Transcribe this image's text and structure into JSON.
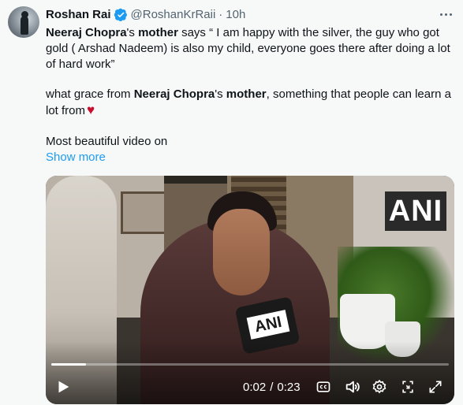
{
  "tweet": {
    "author_name": "Roshan Rai",
    "author_handle": "@RoshanKrRaii",
    "separator": "·",
    "time": "10h",
    "paragraph1": {
      "b1": "Neeraj Chopra",
      "t1": "'s ",
      "b2": "mother",
      "t2": " says “ I am happy with the silver, the guy who got gold ( Arshad Nadeem) is also my child, everyone goes there after doing a lot of hard work”"
    },
    "paragraph2": {
      "t1": "what grace from ",
      "b1": "Neeraj Chopra",
      "t2": "'s ",
      "b2": "mother",
      "t3": ", something that people can learn a lot from"
    },
    "paragraph3": "Most beautiful video on",
    "show_more": "Show more",
    "heart_emoji": "♥"
  },
  "icons": {
    "avatar": "avatar-image",
    "verified": "verified-badge-icon",
    "more": "more-options-icon"
  },
  "colors": {
    "link": "#1d9bf0",
    "verified": "#1d9bf0",
    "secondary_text": "#536471",
    "heart": "#c8102e"
  },
  "video": {
    "watermark": "ANI",
    "mic_label": "ANI",
    "current_time": "0:02",
    "duration": "0:23",
    "time_separator": "/",
    "progress": 0.087,
    "controls": [
      "play-icon",
      "captions-icon",
      "volume-icon",
      "settings-icon",
      "minimize-icon",
      "fullscreen-icon"
    ]
  }
}
